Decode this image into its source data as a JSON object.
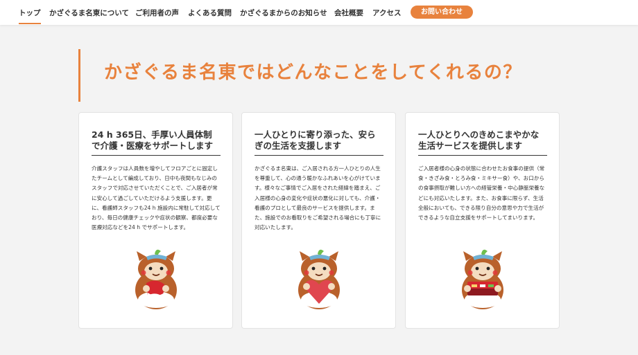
{
  "nav": {
    "items": [
      {
        "label": "トップ",
        "active": true
      },
      {
        "label": "かざぐるま名東について"
      },
      {
        "label": "ご利用者の声"
      },
      {
        "label": "よくある質問"
      },
      {
        "label": "かざぐるまからのお知らせ"
      },
      {
        "label": "会社概要"
      },
      {
        "label": "アクセス"
      }
    ],
    "contact_label": "お問い合わせ"
  },
  "heading": "かざぐるま名東ではどんなことをしてくれるの？",
  "cards": [
    {
      "title": "24 h 365日、手厚い人員体制で介護・医療をサポートします",
      "body": "介護スタッフは人員数を増やしてフロアごとに固定したチームとして編成しており、日中も夜間もなじみのスタッフで対応させていただくことで、ご入居者が常に安心して過ごしていただけるよう支援します。更に、看護師スタッフも24 h 施設内に常駐して対応しており、毎日の健康チェックや症状の観察、都度必要な医療対応などを24 h でサポートします。",
      "mascot": "mascot-holding-towel-icon"
    },
    {
      "title": "一人ひとりに寄り添った、安らぎの生活を支援します",
      "body": "かざぐるま名東は、ご入居される方一人ひとりの人生を尊重して、心の通う暖かなふれあいを心がけています。様々なご事情でご入居をされた経緯を踏まえ、ご入居様の心身の変化や症状の悪化に対しても、介護・看護のプロとして最良のサービスを提供します。また、施設でのお看取りをご希望される場合にも丁寧に対応いたします。",
      "mascot": "mascot-holding-heart-icon"
    },
    {
      "title": "一人ひとりへのきめこまやかな生活サービスを提供します",
      "body": "ご入居者様の心身の状態に合わせたお食事の提供（常食・きざみ食・とろみ食・ミキサー食）や、お口からの食事摂取が難しい方への経管栄養・中心静脈栄養などにも対応いたします。また、お食事に限らず、生活全般においても、できる限り自分の意思や力で生活ができるような自立支援をサポートしてまいります。",
      "mascot": "mascot-holding-lunchbox-icon"
    }
  ],
  "colors": {
    "accent": "#e8823d",
    "background": "#f3f3f3",
    "card": "#ffffff"
  }
}
